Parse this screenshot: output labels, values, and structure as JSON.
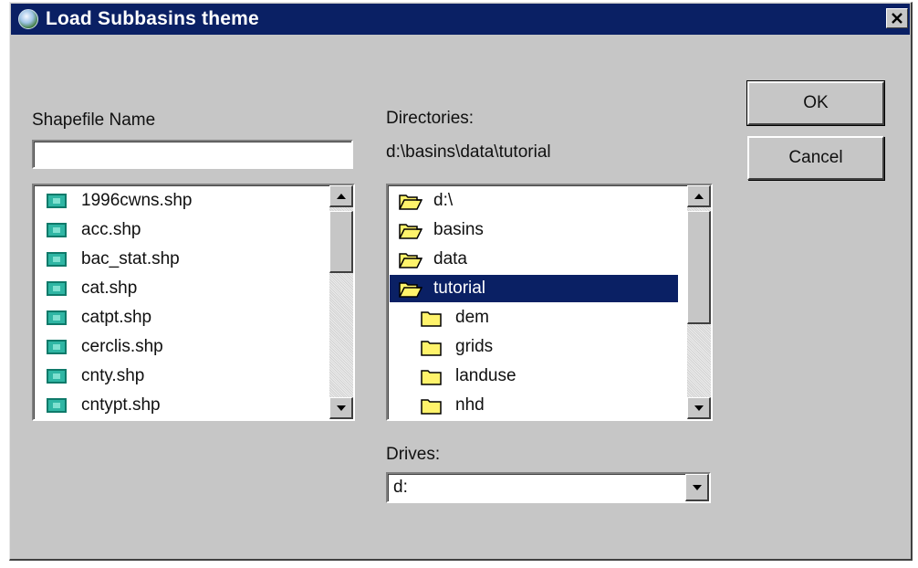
{
  "window": {
    "title": "Load Subbasins theme",
    "app_icon": "globe-icon",
    "close_icon": "close-icon"
  },
  "shapefile": {
    "label": "Shapefile Name",
    "value": "",
    "files": [
      {
        "name": "1996cwns.shp",
        "icon": "shapefile-icon"
      },
      {
        "name": "acc.shp",
        "icon": "shapefile-icon"
      },
      {
        "name": "bac_stat.shp",
        "icon": "shapefile-icon"
      },
      {
        "name": "cat.shp",
        "icon": "shapefile-icon"
      },
      {
        "name": "catpt.shp",
        "icon": "shapefile-icon"
      },
      {
        "name": "cerclis.shp",
        "icon": "shapefile-icon"
      },
      {
        "name": "cnty.shp",
        "icon": "shapefile-icon"
      },
      {
        "name": "cntypt.shp",
        "icon": "shapefile-icon"
      }
    ]
  },
  "directories": {
    "label": "Directories:",
    "current_path": "d:\\basins\\data\\tutorial",
    "items": [
      {
        "name": "d:\\",
        "icon": "open-folder-icon"
      },
      {
        "name": "basins",
        "icon": "open-folder-icon"
      },
      {
        "name": "data",
        "icon": "open-folder-icon"
      },
      {
        "name": "tutorial",
        "icon": "open-folder-icon",
        "selected": true
      },
      {
        "name": "dem",
        "icon": "folder-icon"
      },
      {
        "name": "grids",
        "icon": "folder-icon"
      },
      {
        "name": "landuse",
        "icon": "folder-icon"
      },
      {
        "name": "nhd",
        "icon": "folder-icon"
      }
    ]
  },
  "drives": {
    "label": "Drives:",
    "selected": "d:"
  },
  "buttons": {
    "ok": "OK",
    "cancel": "Cancel"
  },
  "colors": {
    "titlebar": "#0a2064",
    "dialog_bg": "#c6c6c6",
    "selection": "#0a2064",
    "folder": "#fff36b",
    "shapefile": "#2fb6a4"
  }
}
